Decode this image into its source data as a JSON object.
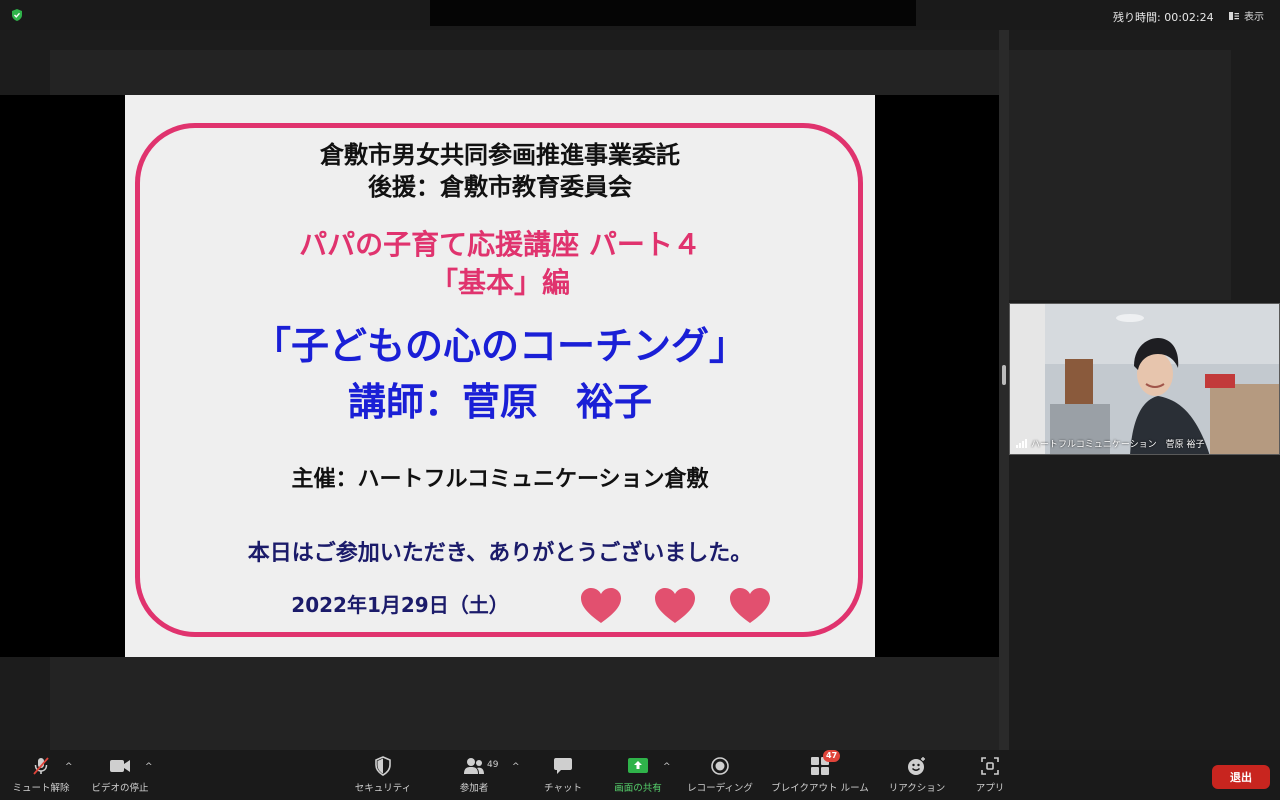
{
  "topbar": {
    "remaining_label": "残り時間: 00:02:24",
    "view_label": "表示",
    "security_icon": "shield-check-icon"
  },
  "slide": {
    "sponsor_line1": "倉敷市男女共同参画推進事業委託",
    "sponsor_line2": "後援：倉敷市教育委員会",
    "course_line1": "パパの子育て応援講座 パート４",
    "course_line2": "「基本」編",
    "topic": "「子どもの心のコーチング」",
    "lecturer": "講師：菅原　裕子",
    "organizer": "主催：ハートフルコミュニケーション倉敷",
    "thanks": "本日はご参加いただき、ありがとうございました。",
    "date": "2022年1月29日（土）",
    "colors": {
      "frame": "#e0336e",
      "course": "#e0336e",
      "topic": "#1a1fd6",
      "thanks": "#1b1b6a",
      "heart": "#e2506f"
    }
  },
  "participant": {
    "name": "ハートフルコミュニケーション　菅原 裕子"
  },
  "toolbar": {
    "mute_label": "ミュート解除",
    "video_label": "ビデオの停止",
    "security_label": "セキュリティ",
    "participants_label": "参加者",
    "participants_count": "49",
    "chat_label": "チャット",
    "share_label": "画面の共有",
    "record_label": "レコーディング",
    "breakout_label": "ブレイクアウト ルーム",
    "breakout_count": "47",
    "reactions_label": "リアクション",
    "apps_label": "アプリ",
    "leave_label": "退出",
    "caret": "^",
    "colors": {
      "share_active": "#2fb34a",
      "leave": "#c8251f"
    }
  }
}
